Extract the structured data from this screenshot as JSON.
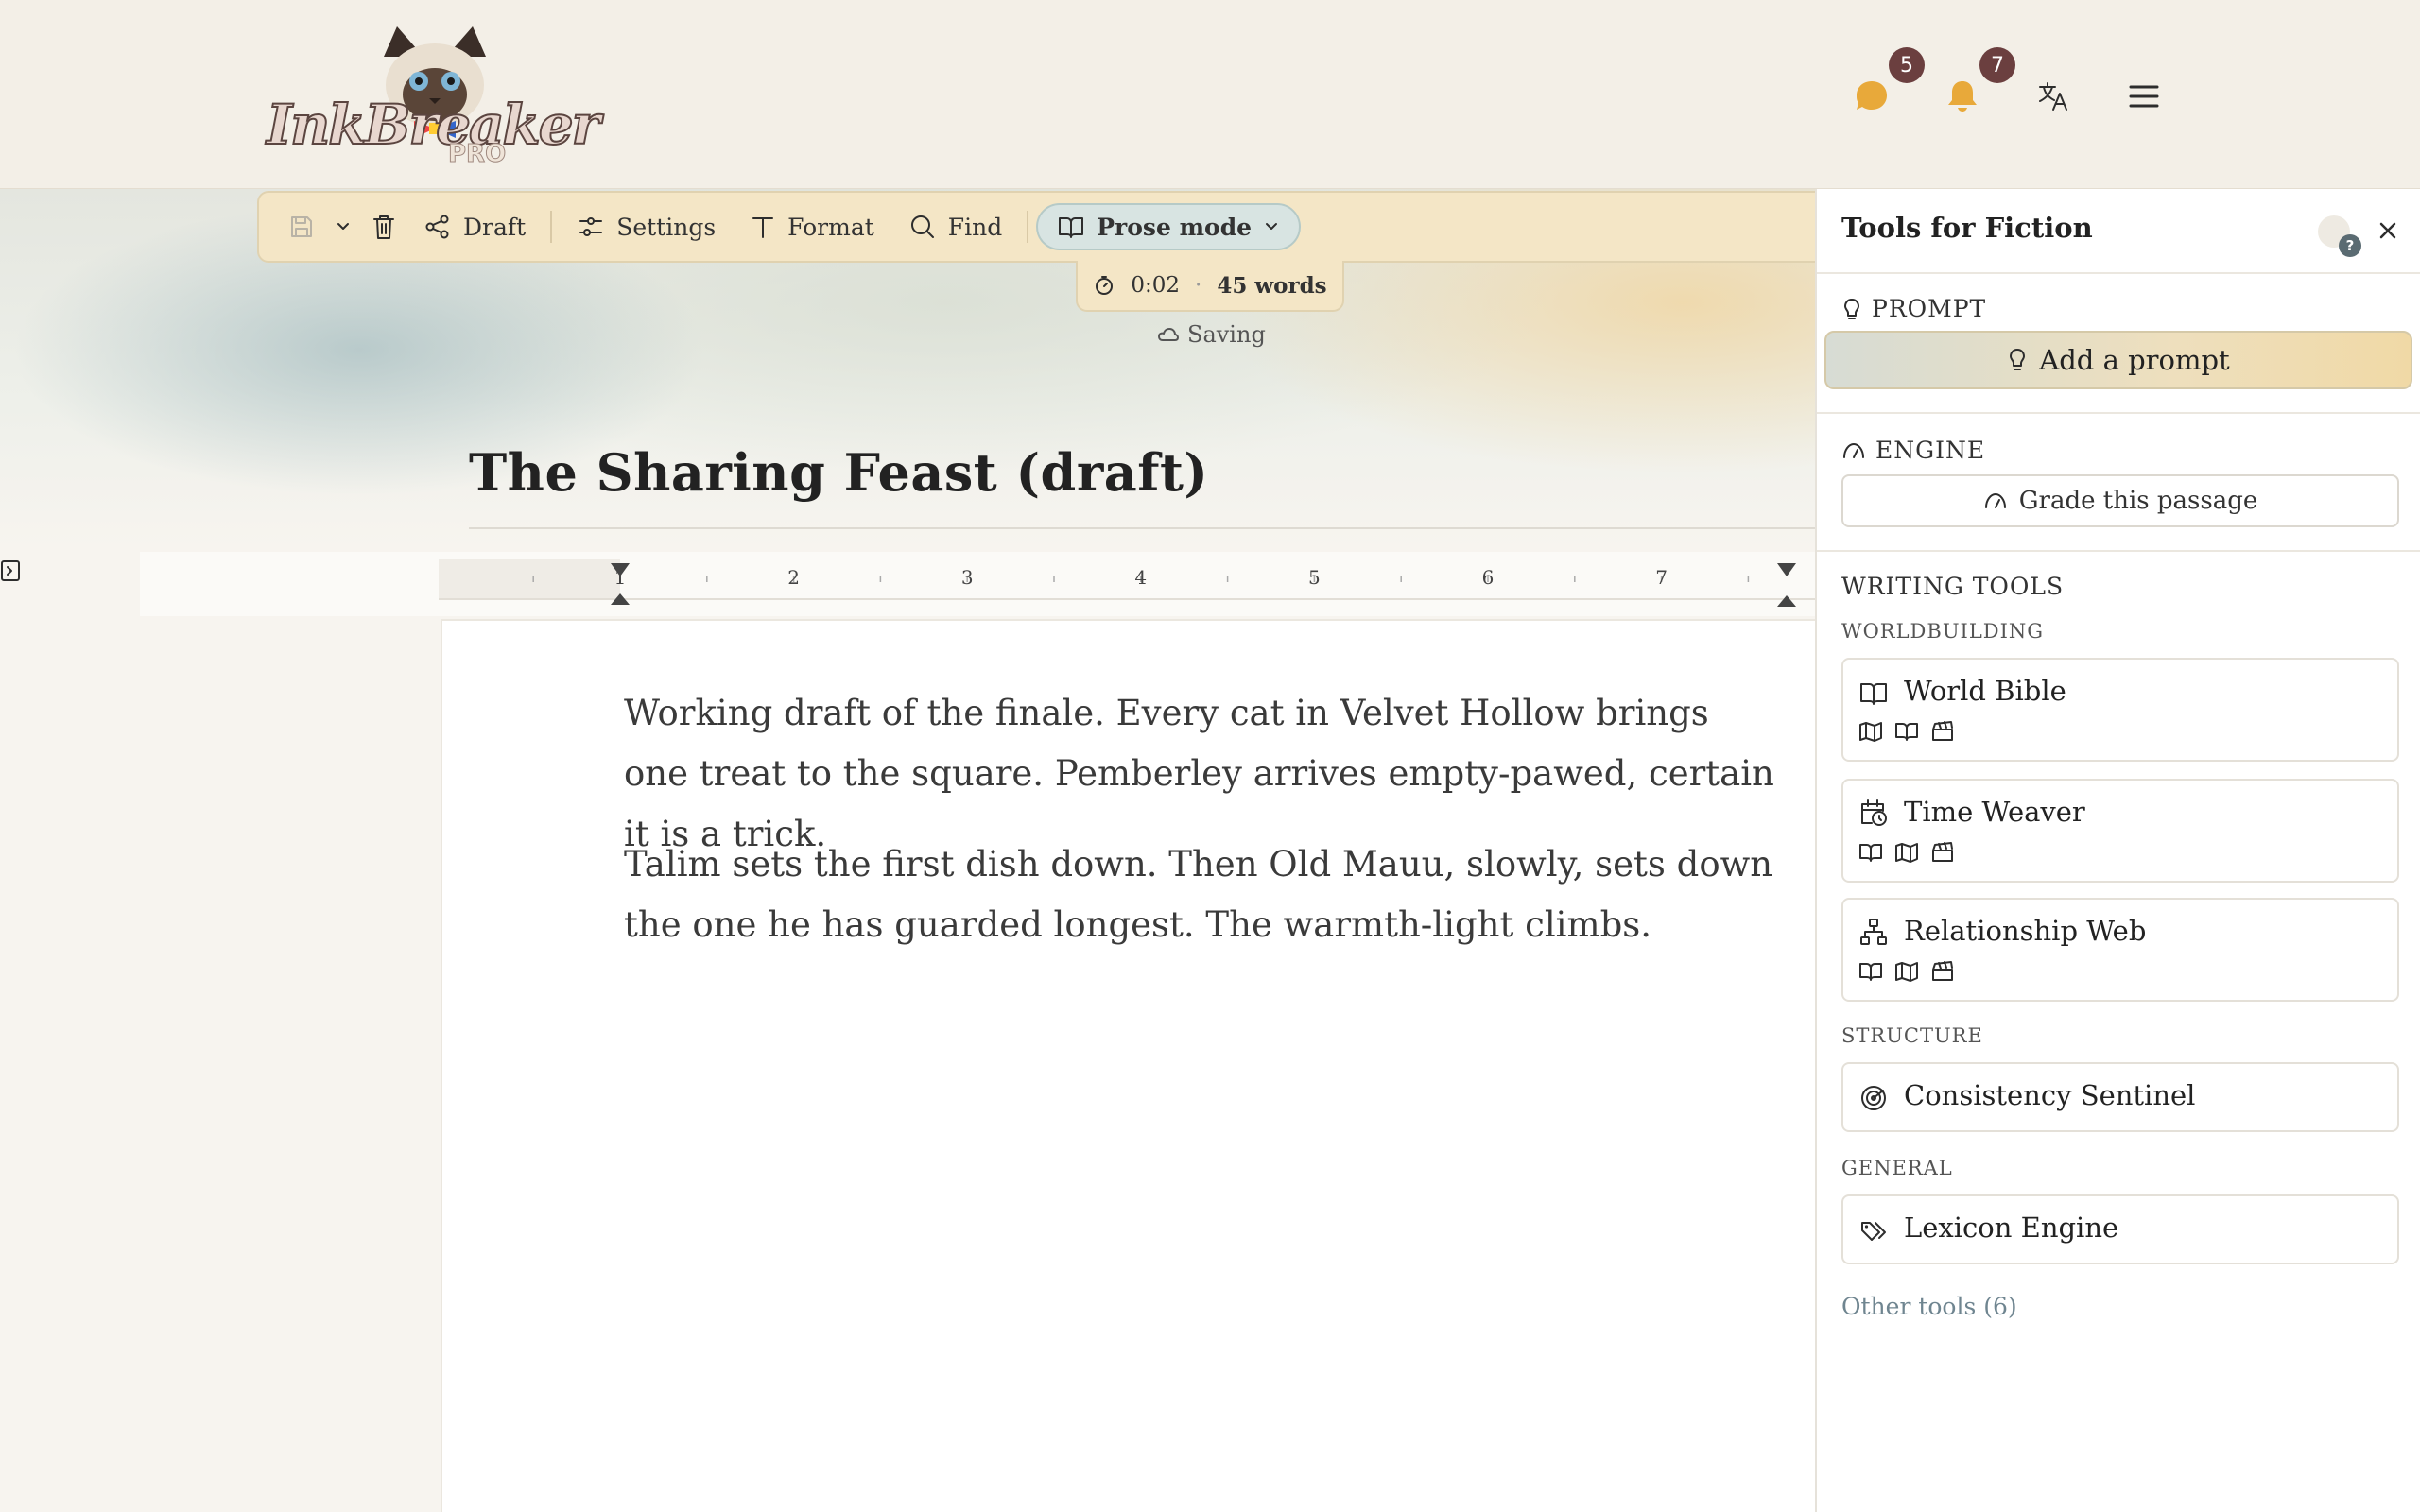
{
  "app": {
    "name": "InkBreaker",
    "edition": "PRO"
  },
  "header": {
    "chat_badge": "5",
    "notifications_badge": "7"
  },
  "toolbar": {
    "draft_label": "Draft",
    "settings_label": "Settings",
    "format_label": "Format",
    "find_label": "Find",
    "mode_label": "Prose mode"
  },
  "stats": {
    "timer": "0:02",
    "separator": "·",
    "words": "45 words"
  },
  "status": {
    "saving": "Saving"
  },
  "document": {
    "title": "The Sharing Feast (draft)",
    "ruler_marks": [
      "1",
      "2",
      "3",
      "4",
      "5",
      "6",
      "7"
    ],
    "paragraphs": [
      "Working draft of the finale. Every cat in Velvet Hollow brings one treat to the square. Pemberley arrives empty-pawed, certain it is a trick.",
      "Talim sets the first dish down. Then Old Mauu, slowly, sets down the one he has guarded longest. The warmth-light climbs."
    ]
  },
  "panel": {
    "title": "Tools for Fiction",
    "help_badge": "?",
    "prompt_heading": "PROMPT",
    "add_prompt_label": "Add a prompt",
    "engine_heading": "ENGINE",
    "grade_label": "Grade this passage",
    "writing_tools_heading": "WRITING TOOLS",
    "categories": {
      "worldbuilding": "WORLDBUILDING",
      "structure": "STRUCTURE",
      "general": "GENERAL"
    },
    "tools": {
      "world_bible": "World Bible",
      "time_weaver": "Time Weaver",
      "relationship_web": "Relationship Web",
      "consistency_sentinel": "Consistency Sentinel",
      "lexicon_engine": "Lexicon Engine"
    },
    "other_tools": "Other tools (6)"
  },
  "colors": {
    "accent_badge": "#6b3f3f",
    "notification_icon": "#e8a93a",
    "toolbar_bg": "#f4e6c6",
    "link": "#6f8590"
  }
}
